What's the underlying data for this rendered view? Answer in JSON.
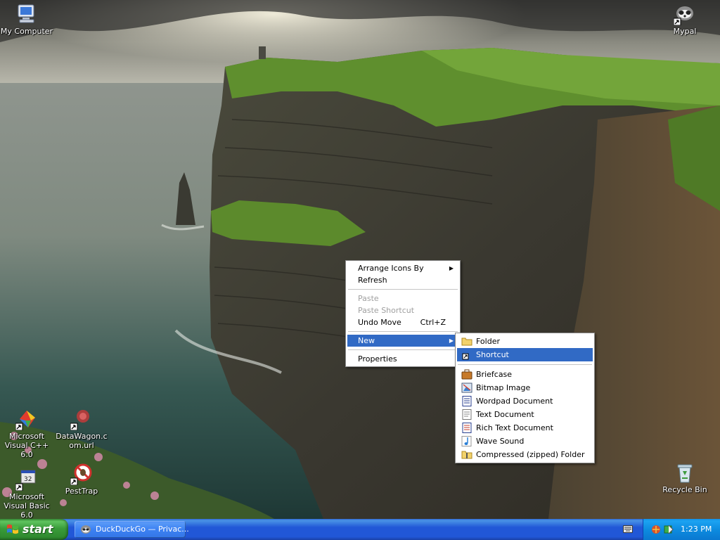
{
  "desktop": {
    "icons": {
      "my_computer": "My Computer",
      "mypal": "Mypal",
      "ms_visual_cpp": "Microsoft Visual C++ 6.0",
      "datawagon": "DataWagon.com.url",
      "ms_visual_basic": "Microsoft Visual Basic 6.0",
      "pesttrap": "PestTrap",
      "recycle_bin": "Recycle Bin"
    }
  },
  "context_menu": {
    "arrange_icons_by": "Arrange Icons By",
    "refresh": "Refresh",
    "paste": "Paste",
    "paste_shortcut": "Paste Shortcut",
    "undo_move": "Undo Move",
    "undo_move_shortcut": "Ctrl+Z",
    "new": "New",
    "properties": "Properties"
  },
  "new_submenu": {
    "folder": "Folder",
    "shortcut": "Shortcut",
    "briefcase": "Briefcase",
    "bitmap_image": "Bitmap Image",
    "wordpad_document": "Wordpad Document",
    "text_document": "Text Document",
    "rich_text_document": "Rich Text Document",
    "wave_sound": "Wave Sound",
    "compressed_folder": "Compressed (zipped) Folder"
  },
  "taskbar": {
    "start_label": "start",
    "task_button": "DuckDuckGo — Privac...",
    "clock": "1:23 PM"
  },
  "colors": {
    "taskbar_blue": "#2157d7",
    "start_green": "#3a9c3a",
    "menu_highlight": "#316ac5",
    "tray_blue": "#0d8ce0"
  }
}
